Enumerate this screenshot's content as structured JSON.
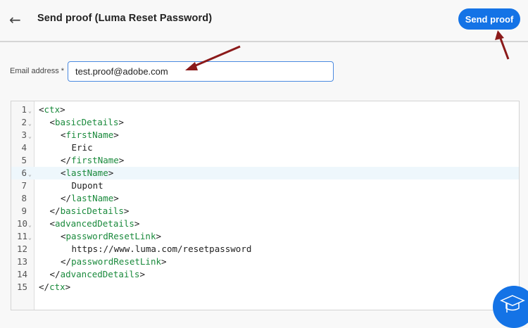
{
  "header": {
    "title": "Send proof (Luma Reset Password)",
    "send_label": "Send proof"
  },
  "form": {
    "email_label": "Email address",
    "required_mark": "*",
    "email_value": "test.proof@adobe.com"
  },
  "editor": {
    "lines": [
      {
        "n": "1",
        "fold": true,
        "indent": 0,
        "pre": "<",
        "tag": "ctx",
        "post": ">"
      },
      {
        "n": "2",
        "fold": true,
        "indent": 1,
        "pre": "<",
        "tag": "basicDetails",
        "post": ">"
      },
      {
        "n": "3",
        "fold": true,
        "indent": 2,
        "pre": "<",
        "tag": "firstName",
        "post": ">"
      },
      {
        "n": "4",
        "fold": false,
        "indent": 3,
        "text": "Eric"
      },
      {
        "n": "5",
        "fold": false,
        "indent": 2,
        "pre": "</",
        "tag": "firstName",
        "post": ">"
      },
      {
        "n": "6",
        "fold": true,
        "indent": 2,
        "pre": "<",
        "tag": "lastName",
        "post": ">",
        "highlight": true
      },
      {
        "n": "7",
        "fold": false,
        "indent": 3,
        "text": "Dupont"
      },
      {
        "n": "8",
        "fold": false,
        "indent": 2,
        "pre": "</",
        "tag": "lastName",
        "post": ">"
      },
      {
        "n": "9",
        "fold": false,
        "indent": 1,
        "pre": "</",
        "tag": "basicDetails",
        "post": ">"
      },
      {
        "n": "10",
        "fold": true,
        "indent": 1,
        "pre": "<",
        "tag": "advancedDetails",
        "post": ">"
      },
      {
        "n": "11",
        "fold": true,
        "indent": 2,
        "pre": "<",
        "tag": "passwordResetLink",
        "post": ">"
      },
      {
        "n": "12",
        "fold": false,
        "indent": 3,
        "text": "https://www.luma.com/resetpassword"
      },
      {
        "n": "13",
        "fold": false,
        "indent": 2,
        "pre": "</",
        "tag": "passwordResetLink",
        "post": ">"
      },
      {
        "n": "14",
        "fold": false,
        "indent": 1,
        "pre": "</",
        "tag": "advancedDetails",
        "post": ">"
      },
      {
        "n": "15",
        "fold": false,
        "indent": 0,
        "pre": "</",
        "tag": "ctx",
        "post": ">"
      }
    ]
  },
  "colors": {
    "accent": "#1473e6",
    "tag": "#1a8a3c",
    "arrow": "#8b1a1a"
  }
}
